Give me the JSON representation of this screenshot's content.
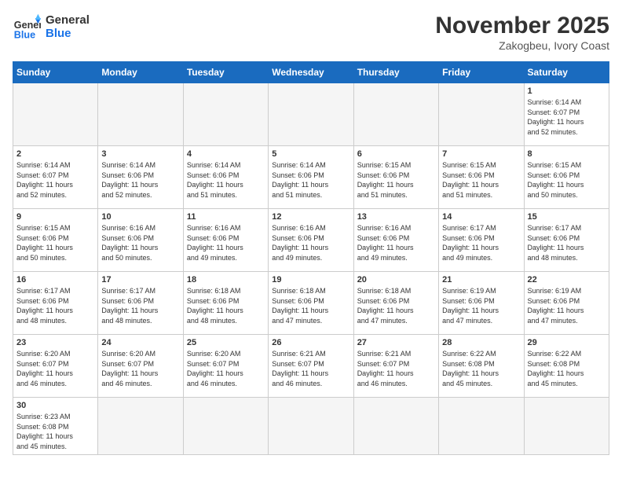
{
  "header": {
    "logo_general": "General",
    "logo_blue": "Blue",
    "month_title": "November 2025",
    "location": "Zakogbeu, Ivory Coast"
  },
  "days_of_week": [
    "Sunday",
    "Monday",
    "Tuesday",
    "Wednesday",
    "Thursday",
    "Friday",
    "Saturday"
  ],
  "weeks": [
    [
      {
        "day": "",
        "info": ""
      },
      {
        "day": "",
        "info": ""
      },
      {
        "day": "",
        "info": ""
      },
      {
        "day": "",
        "info": ""
      },
      {
        "day": "",
        "info": ""
      },
      {
        "day": "",
        "info": ""
      },
      {
        "day": "1",
        "info": "Sunrise: 6:14 AM\nSunset: 6:07 PM\nDaylight: 11 hours\nand 52 minutes."
      }
    ],
    [
      {
        "day": "2",
        "info": "Sunrise: 6:14 AM\nSunset: 6:07 PM\nDaylight: 11 hours\nand 52 minutes."
      },
      {
        "day": "3",
        "info": "Sunrise: 6:14 AM\nSunset: 6:06 PM\nDaylight: 11 hours\nand 52 minutes."
      },
      {
        "day": "4",
        "info": "Sunrise: 6:14 AM\nSunset: 6:06 PM\nDaylight: 11 hours\nand 51 minutes."
      },
      {
        "day": "5",
        "info": "Sunrise: 6:14 AM\nSunset: 6:06 PM\nDaylight: 11 hours\nand 51 minutes."
      },
      {
        "day": "6",
        "info": "Sunrise: 6:15 AM\nSunset: 6:06 PM\nDaylight: 11 hours\nand 51 minutes."
      },
      {
        "day": "7",
        "info": "Sunrise: 6:15 AM\nSunset: 6:06 PM\nDaylight: 11 hours\nand 51 minutes."
      },
      {
        "day": "8",
        "info": "Sunrise: 6:15 AM\nSunset: 6:06 PM\nDaylight: 11 hours\nand 50 minutes."
      }
    ],
    [
      {
        "day": "9",
        "info": "Sunrise: 6:15 AM\nSunset: 6:06 PM\nDaylight: 11 hours\nand 50 minutes."
      },
      {
        "day": "10",
        "info": "Sunrise: 6:16 AM\nSunset: 6:06 PM\nDaylight: 11 hours\nand 50 minutes."
      },
      {
        "day": "11",
        "info": "Sunrise: 6:16 AM\nSunset: 6:06 PM\nDaylight: 11 hours\nand 49 minutes."
      },
      {
        "day": "12",
        "info": "Sunrise: 6:16 AM\nSunset: 6:06 PM\nDaylight: 11 hours\nand 49 minutes."
      },
      {
        "day": "13",
        "info": "Sunrise: 6:16 AM\nSunset: 6:06 PM\nDaylight: 11 hours\nand 49 minutes."
      },
      {
        "day": "14",
        "info": "Sunrise: 6:17 AM\nSunset: 6:06 PM\nDaylight: 11 hours\nand 49 minutes."
      },
      {
        "day": "15",
        "info": "Sunrise: 6:17 AM\nSunset: 6:06 PM\nDaylight: 11 hours\nand 48 minutes."
      }
    ],
    [
      {
        "day": "16",
        "info": "Sunrise: 6:17 AM\nSunset: 6:06 PM\nDaylight: 11 hours\nand 48 minutes."
      },
      {
        "day": "17",
        "info": "Sunrise: 6:17 AM\nSunset: 6:06 PM\nDaylight: 11 hours\nand 48 minutes."
      },
      {
        "day": "18",
        "info": "Sunrise: 6:18 AM\nSunset: 6:06 PM\nDaylight: 11 hours\nand 48 minutes."
      },
      {
        "day": "19",
        "info": "Sunrise: 6:18 AM\nSunset: 6:06 PM\nDaylight: 11 hours\nand 47 minutes."
      },
      {
        "day": "20",
        "info": "Sunrise: 6:18 AM\nSunset: 6:06 PM\nDaylight: 11 hours\nand 47 minutes."
      },
      {
        "day": "21",
        "info": "Sunrise: 6:19 AM\nSunset: 6:06 PM\nDaylight: 11 hours\nand 47 minutes."
      },
      {
        "day": "22",
        "info": "Sunrise: 6:19 AM\nSunset: 6:06 PM\nDaylight: 11 hours\nand 47 minutes."
      }
    ],
    [
      {
        "day": "23",
        "info": "Sunrise: 6:20 AM\nSunset: 6:07 PM\nDaylight: 11 hours\nand 46 minutes."
      },
      {
        "day": "24",
        "info": "Sunrise: 6:20 AM\nSunset: 6:07 PM\nDaylight: 11 hours\nand 46 minutes."
      },
      {
        "day": "25",
        "info": "Sunrise: 6:20 AM\nSunset: 6:07 PM\nDaylight: 11 hours\nand 46 minutes."
      },
      {
        "day": "26",
        "info": "Sunrise: 6:21 AM\nSunset: 6:07 PM\nDaylight: 11 hours\nand 46 minutes."
      },
      {
        "day": "27",
        "info": "Sunrise: 6:21 AM\nSunset: 6:07 PM\nDaylight: 11 hours\nand 46 minutes."
      },
      {
        "day": "28",
        "info": "Sunrise: 6:22 AM\nSunset: 6:08 PM\nDaylight: 11 hours\nand 45 minutes."
      },
      {
        "day": "29",
        "info": "Sunrise: 6:22 AM\nSunset: 6:08 PM\nDaylight: 11 hours\nand 45 minutes."
      }
    ],
    [
      {
        "day": "30",
        "info": "Sunrise: 6:23 AM\nSunset: 6:08 PM\nDaylight: 11 hours\nand 45 minutes."
      },
      {
        "day": "",
        "info": ""
      },
      {
        "day": "",
        "info": ""
      },
      {
        "day": "",
        "info": ""
      },
      {
        "day": "",
        "info": ""
      },
      {
        "day": "",
        "info": ""
      },
      {
        "day": "",
        "info": ""
      }
    ]
  ]
}
